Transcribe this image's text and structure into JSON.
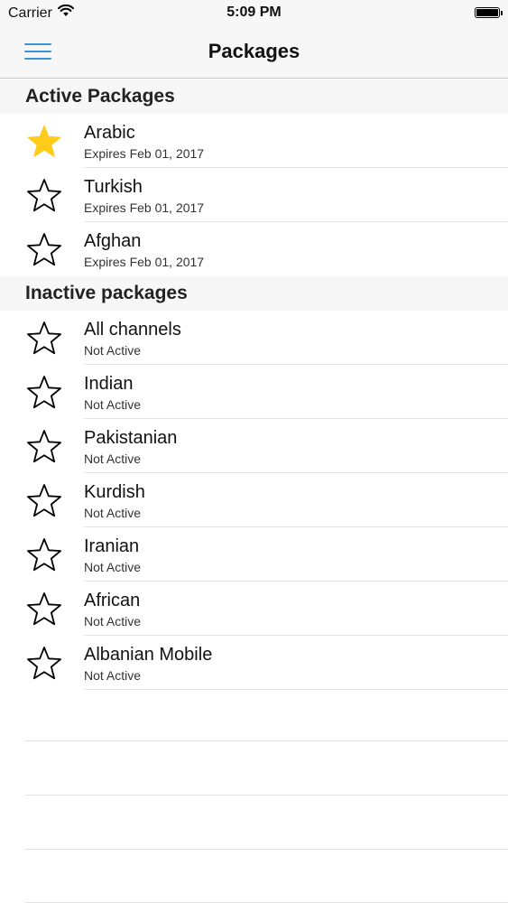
{
  "status_bar": {
    "carrier": "Carrier",
    "time": "5:09 PM"
  },
  "nav": {
    "title": "Packages",
    "menu_icon": "hamburger-menu-icon",
    "accent_color": "#3a93d8"
  },
  "active_section": {
    "header": "Active Packages",
    "items": [
      {
        "title": "Arabic",
        "subtitle": "Expires Feb 01, 2017",
        "favorite": true
      },
      {
        "title": "Turkish",
        "subtitle": "Expires Feb 01, 2017",
        "favorite": false
      },
      {
        "title": "Afghan",
        "subtitle": "Expires Feb 01, 2017",
        "favorite": false
      }
    ]
  },
  "inactive_section": {
    "header": "Inactive packages",
    "items": [
      {
        "title": "All channels",
        "subtitle": "Not Active",
        "favorite": false
      },
      {
        "title": "Indian",
        "subtitle": "Not Active",
        "favorite": false
      },
      {
        "title": "Pakistanian",
        "subtitle": "Not Active",
        "favorite": false
      },
      {
        "title": "Kurdish",
        "subtitle": "Not Active",
        "favorite": false
      },
      {
        "title": "Iranian",
        "subtitle": "Not Active",
        "favorite": false
      },
      {
        "title": "African",
        "subtitle": "Not Active",
        "favorite": false
      },
      {
        "title": "Albanian Mobile",
        "subtitle": "Not Active",
        "favorite": false
      }
    ]
  },
  "colors": {
    "star_filled": "#ffcc1a",
    "star_outline": "#000000"
  }
}
